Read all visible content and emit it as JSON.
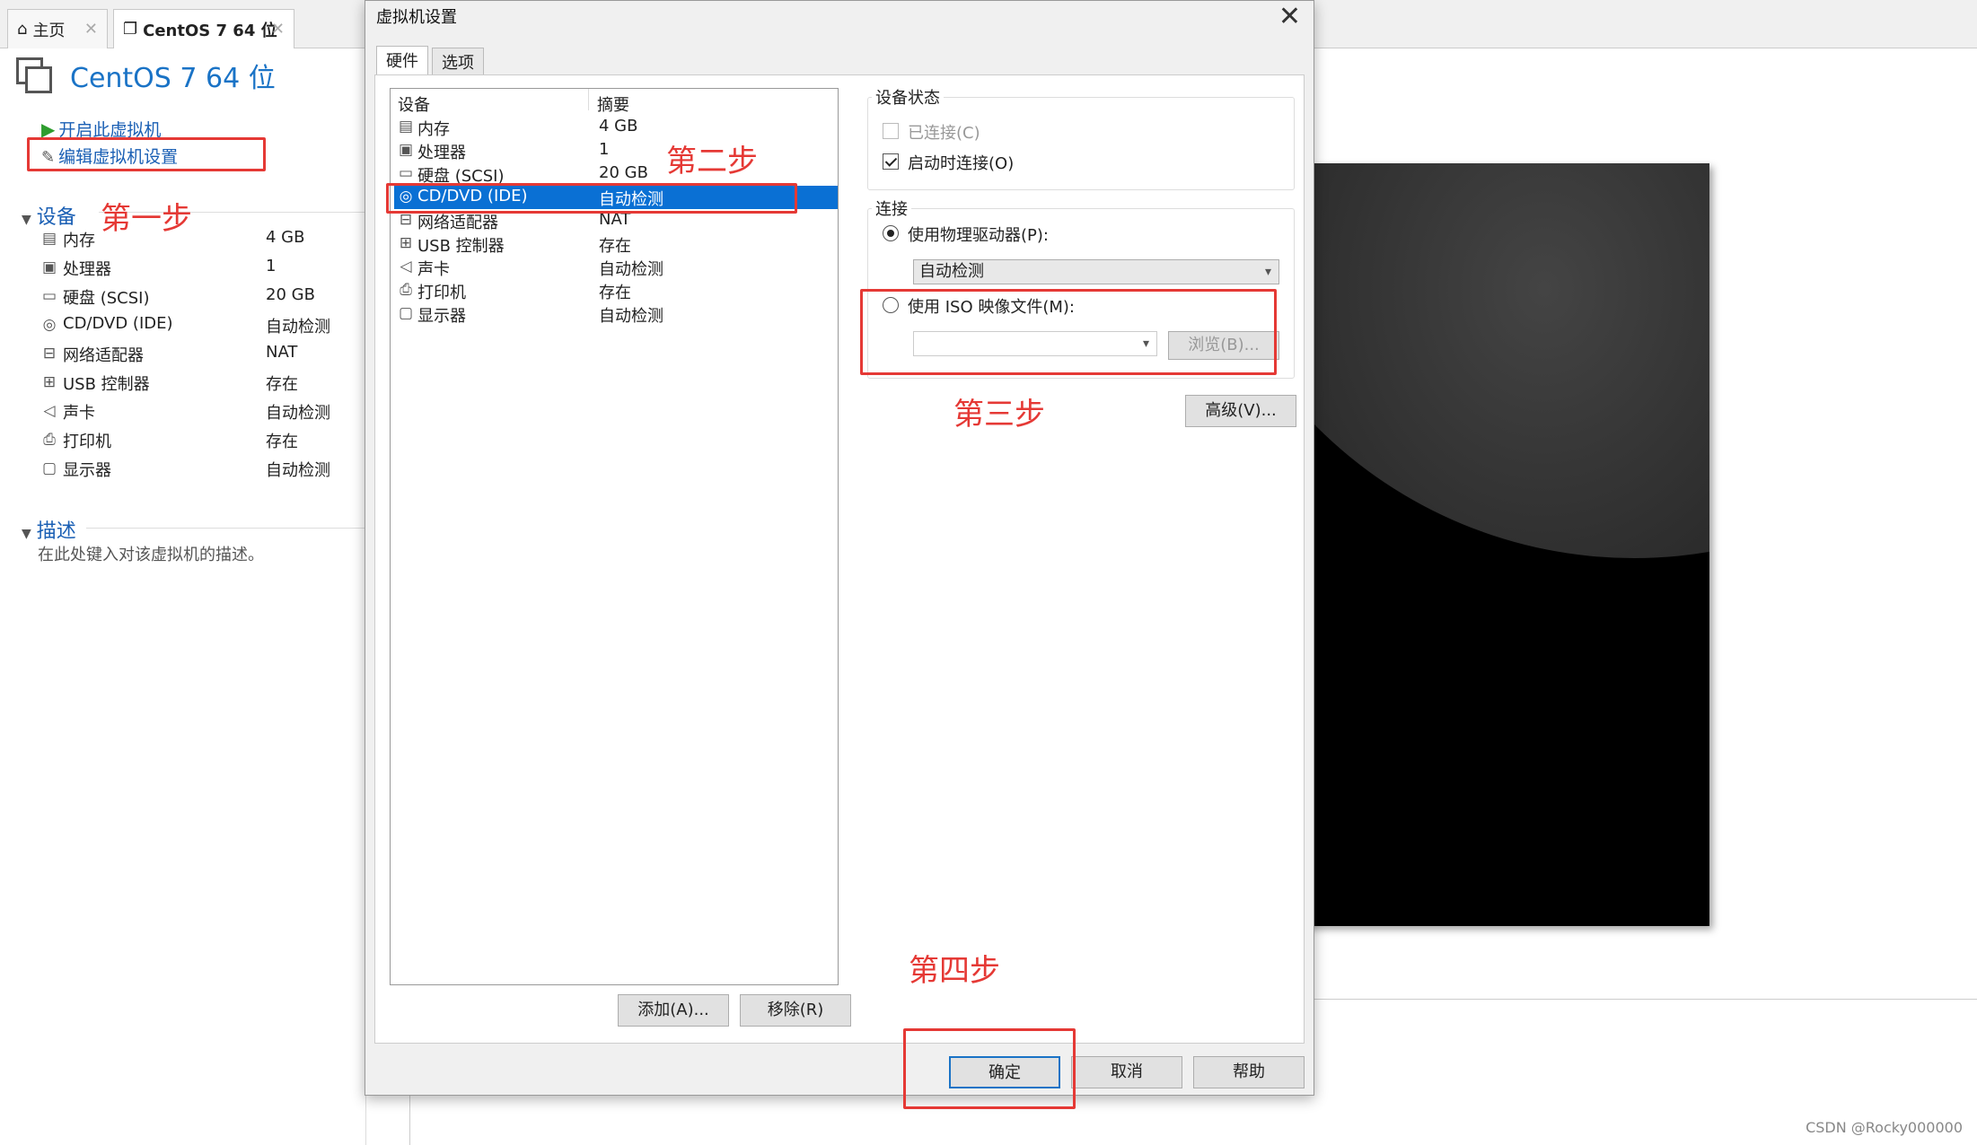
{
  "app": {
    "tabs": [
      {
        "label": "主页"
      },
      {
        "label": "CentOS 7 64 位"
      }
    ],
    "vm_title": "CentOS 7 64 位",
    "actions": {
      "start": "开启此虚拟机",
      "edit": "编辑虚拟机设置"
    },
    "devices_header": "设备",
    "devices": [
      {
        "icon": "memory-icon",
        "name": "内存",
        "value": "4 GB"
      },
      {
        "icon": "cpu-icon",
        "name": "处理器",
        "value": "1"
      },
      {
        "icon": "harddisk-icon",
        "name": "硬盘 (SCSI)",
        "value": "20 GB"
      },
      {
        "icon": "cd-icon",
        "name": "CD/DVD (IDE)",
        "value": "自动检测"
      },
      {
        "icon": "network-icon",
        "name": "网络适配器",
        "value": "NAT"
      },
      {
        "icon": "usb-icon",
        "name": "USB 控制器",
        "value": "存在"
      },
      {
        "icon": "sound-icon",
        "name": "声卡",
        "value": "自动检测"
      },
      {
        "icon": "printer-icon",
        "name": "打印机",
        "value": "存在"
      },
      {
        "icon": "display-icon",
        "name": "显示器",
        "value": "自动检测"
      }
    ],
    "desc_header": "描述",
    "desc_placeholder": "在此处键入对该虚拟机的描述。"
  },
  "annotations": {
    "step1": "第一步",
    "step2": "第二步",
    "step3": "第三步",
    "step4": "第四步",
    "color": "#e53935"
  },
  "dialog": {
    "title": "虚拟机设置",
    "tabs": [
      "硬件",
      "选项"
    ],
    "list_headers": {
      "device": "设备",
      "summary": "摘要"
    },
    "items": [
      {
        "icon": "memory-icon",
        "name": "内存",
        "value": "4 GB"
      },
      {
        "icon": "cpu-icon",
        "name": "处理器",
        "value": "1"
      },
      {
        "icon": "harddisk-icon",
        "name": "硬盘 (SCSI)",
        "value": "20 GB"
      },
      {
        "icon": "cd-icon",
        "name": "CD/DVD (IDE)",
        "value": "自动检测",
        "selected": true
      },
      {
        "icon": "network-icon",
        "name": "网络适配器",
        "value": "NAT"
      },
      {
        "icon": "usb-icon",
        "name": "USB 控制器",
        "value": "存在"
      },
      {
        "icon": "sound-icon",
        "name": "声卡",
        "value": "自动检测"
      },
      {
        "icon": "printer-icon",
        "name": "打印机",
        "value": "存在"
      },
      {
        "icon": "display-icon",
        "name": "显示器",
        "value": "自动检测"
      }
    ],
    "add_btn": "添加(A)...",
    "remove_btn": "移除(R)",
    "status_group": "设备状态",
    "connected": "已连接(C)",
    "connect_on_start": "启动时连接(O)",
    "connection_group": "连接",
    "use_physical": "使用物理驱动器(P):",
    "physical_value": "自动检测",
    "use_iso": "使用 ISO 映像文件(M):",
    "iso_value": "",
    "browse_btn": "浏览(B)...",
    "advanced_btn": "高级(V)...",
    "ok_btn": "确定",
    "cancel_btn": "取消",
    "help_btn": "帮助"
  },
  "footer_text": "CSDN @Rocky000000",
  "accent": "#1a73c6",
  "select_color": "#0a70d4"
}
